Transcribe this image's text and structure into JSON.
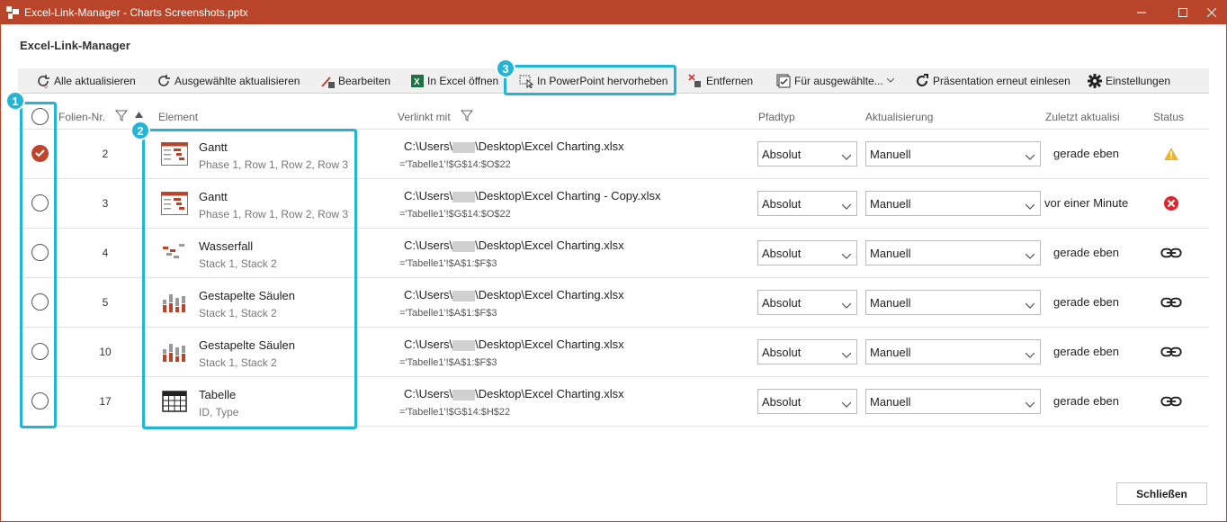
{
  "window": {
    "title": "Excel-Link-Manager - Charts Screenshots.pptx",
    "heading": "Excel-Link-Manager"
  },
  "toolbar": {
    "refresh_all": "Alle aktualisieren",
    "refresh_selected": "Ausgewählte aktualisieren",
    "edit": "Bearbeiten",
    "open_excel": "In Excel öffnen",
    "highlight_ppt": "In PowerPoint hervorheben",
    "remove": "Entfernen",
    "for_selected": "Für ausgewählte...",
    "reload": "Präsentation erneut einlesen",
    "settings": "Einstellungen"
  },
  "callouts": [
    "1",
    "2",
    "3"
  ],
  "columns": {
    "slide_no": "Folien-Nr.",
    "element": "Element",
    "linked_with": "Verlinkt mit",
    "path_type": "Pfadtyp",
    "update": "Aktualisierung",
    "last_updated": "Zuletzt aktualisi",
    "status": "Status"
  },
  "rows": [
    {
      "checked": true,
      "slide": "2",
      "icon": "gantt-icon",
      "name": "Gantt",
      "sub": "Phase 1, Row 1, Row 2, Row 3",
      "path_pre": "C:\\Users\\",
      "path_post": "\\Desktop\\Excel Charting.xlsx",
      "ref": "='Tabelle1'!$G$14:$O$22",
      "path_type": "Absolut",
      "update": "Manuell",
      "last": "gerade eben",
      "status": "warning-icon"
    },
    {
      "checked": false,
      "slide": "3",
      "icon": "gantt-icon",
      "name": "Gantt",
      "sub": "Phase 1, Row 1, Row 2, Row 3",
      "path_pre": "C:\\Users\\",
      "path_post": "\\Desktop\\Excel Charting - Copy.xlsx",
      "ref": "='Tabelle1'!$G$14:$O$22",
      "path_type": "Absolut",
      "update": "Manuell",
      "last": "vor einer Minute",
      "status": "error-icon"
    },
    {
      "checked": false,
      "slide": "4",
      "icon": "waterfall-icon",
      "name": "Wasserfall",
      "sub": "Stack 1, Stack 2",
      "path_pre": "C:\\Users\\",
      "path_post": "\\Desktop\\Excel Charting.xlsx",
      "ref": "='Tabelle1'!$A$1:$F$3",
      "path_type": "Absolut",
      "update": "Manuell",
      "last": "gerade eben",
      "status": "link-icon"
    },
    {
      "checked": false,
      "slide": "5",
      "icon": "stacked-column-icon",
      "name": "Gestapelte Säulen",
      "sub": "Stack 1, Stack 2",
      "path_pre": "C:\\Users\\",
      "path_post": "\\Desktop\\Excel Charting.xlsx",
      "ref": "='Tabelle1'!$A$1:$F$3",
      "path_type": "Absolut",
      "update": "Manuell",
      "last": "gerade eben",
      "status": "link-icon"
    },
    {
      "checked": false,
      "slide": "10",
      "icon": "stacked-column-icon",
      "name": "Gestapelte Säulen",
      "sub": "Stack 1, Stack 2",
      "path_pre": "C:\\Users\\",
      "path_post": "\\Desktop\\Excel Charting.xlsx",
      "ref": "='Tabelle1'!$A$1:$F$3",
      "path_type": "Absolut",
      "update": "Manuell",
      "last": "gerade eben",
      "status": "link-icon"
    },
    {
      "checked": false,
      "slide": "17",
      "icon": "table-icon",
      "name": "Tabelle",
      "sub": "ID, Type",
      "path_pre": "C:\\Users\\",
      "path_post": "\\Desktop\\Excel Charting.xlsx",
      "ref": "='Tabelle1'!$G$14:$H$22",
      "path_type": "Absolut",
      "update": "Manuell",
      "last": "gerade eben",
      "status": "link-icon"
    }
  ],
  "footer": {
    "close": "Schließen"
  },
  "colors": {
    "accent": "#b8452a",
    "highlight": "#22b5d8",
    "error": "#e0242e",
    "warning": "#f0b429"
  }
}
